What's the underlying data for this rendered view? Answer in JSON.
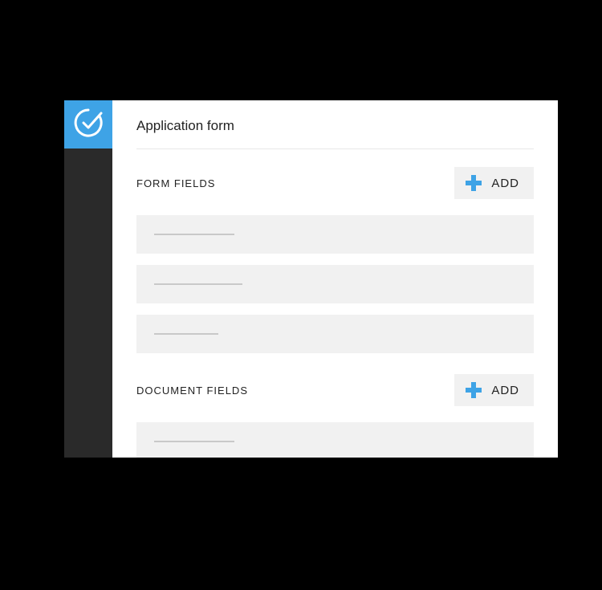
{
  "page": {
    "title": "Application form"
  },
  "sections": {
    "form_fields": {
      "title": "FORM FIELDS",
      "add_label": "ADD"
    },
    "document_fields": {
      "title": "DOCUMENT FIELDS",
      "add_label": "ADD"
    }
  },
  "colors": {
    "accent": "#3ea3e6",
    "sidebar": "#2a2a2a",
    "field_bg": "#f1f1f1"
  }
}
